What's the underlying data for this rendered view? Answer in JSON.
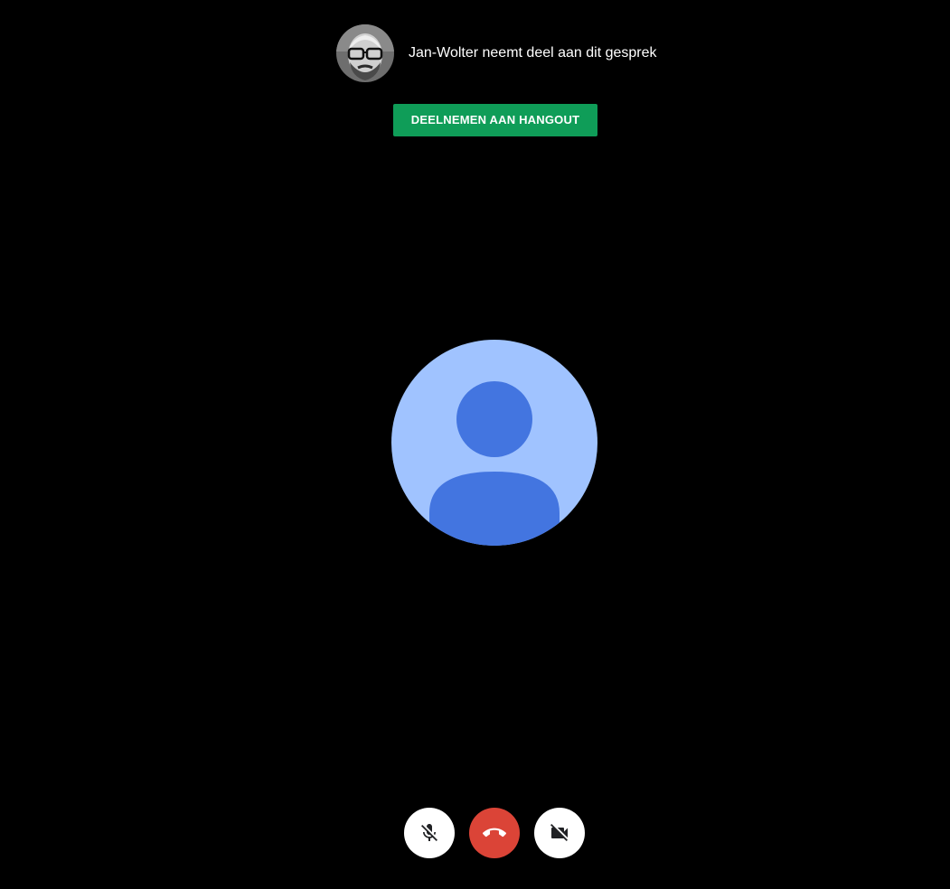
{
  "notice": {
    "text": "Jan-Wolter neemt deel aan dit gesprek",
    "avatar_icon": "participant-photo"
  },
  "join_button": {
    "label": "DEELNEMEN AAN HANGOUT",
    "color": "#0f9d58"
  },
  "participant_avatar": {
    "icon": "default-person-avatar",
    "background_color": "#a0c3ff",
    "figure_color": "#4375e0"
  },
  "controls": {
    "items": [
      {
        "name": "mute-microphone",
        "icon": "mic-off-icon",
        "background": "#ffffff"
      },
      {
        "name": "end-call",
        "icon": "call-end-icon",
        "background": "#db4437"
      },
      {
        "name": "turn-off-camera",
        "icon": "videocam-off-icon",
        "background": "#ffffff"
      }
    ]
  }
}
